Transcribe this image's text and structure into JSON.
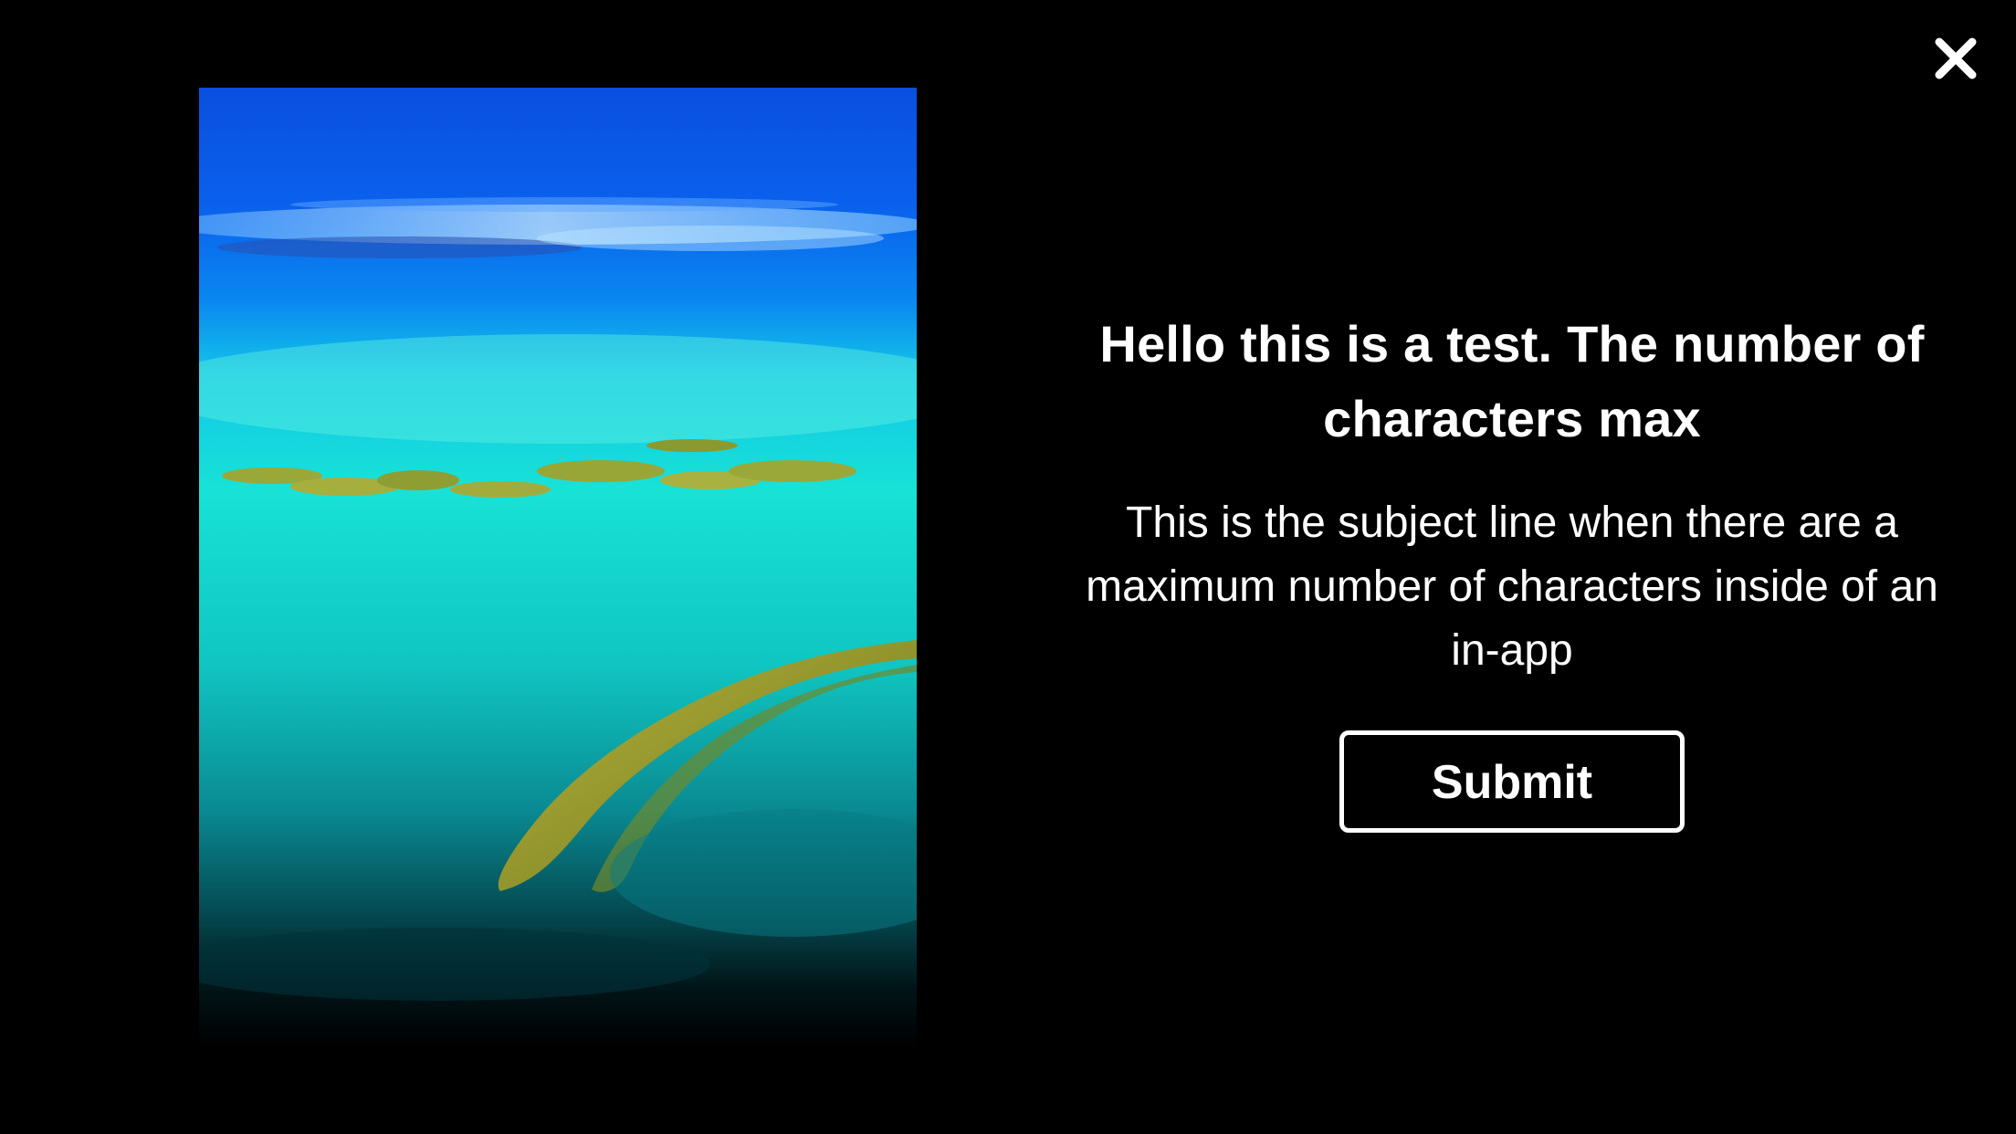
{
  "close": {
    "icon": "close-icon"
  },
  "image": {
    "icon": "ocean-reef-aerial-image"
  },
  "message": {
    "headline": "Hello this is a test. The number of characters max",
    "body": "This is the subject line when there are a maximum number of characters inside of an in-app"
  },
  "actions": {
    "submit_label": "Submit"
  },
  "colors": {
    "background": "#000000",
    "text": "#ffffff",
    "button_border": "#ffffff"
  }
}
